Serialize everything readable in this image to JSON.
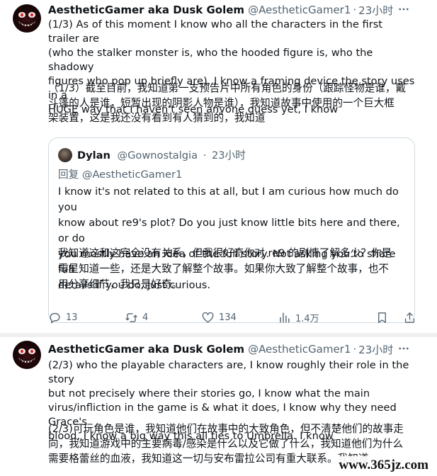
{
  "posts": [
    {
      "author_name": "AestheticGamer aka Dusk Golem",
      "handle": "@AestheticGamer1",
      "separator": "·",
      "time": "23小时",
      "text_en": "(1/3) As of this moment I know who all the characters in the first trailer are\n(who the stalker monster is, who the hooded figure is, who the shadowy\nfigures who pop up briefly are), I know a framing device the story uses in a\nHUGE way that I haven't seen anyone guess yet, I know",
      "text_zh": "（1/3）截至目前，我知道第一支预告片中所有角色的身份（跟踪怪物是谁，戴\n斗篷的人是谁，短暂出现的阴影人物是谁），我知道故事中使用的一个巨大框\n架装置，这是我还没有看到有人猜到的，我知道",
      "quote": {
        "author_name": "Dylan",
        "handle": "@Gownostalgia",
        "separator": "·",
        "time": "23小时",
        "reply_label": "回复",
        "reply_to": "@AestheticGamer1",
        "text_en": "I know it's not related to this at all, but I am curious how much do you\nknow about re9's plot? Do you just know little bits here and there, or do\nyou mostly have  an idea of the full story. Not asking you to share full\ndetails if you do, just curious.",
        "text_zh": "我知道这和这完全没有关系，但我很好奇你对 re9 的剧情了解多少？你是\n零星知道一些，还是大致了解整个故事。如果你大致了解整个故事，也不\n用分享细节，我只是好奇。"
      },
      "actions": {
        "replies": "13",
        "reposts": "4",
        "likes": "134",
        "views": "1.4万"
      }
    },
    {
      "author_name": "AestheticGamer aka Dusk Golem",
      "handle": "@AestheticGamer1",
      "separator": "·",
      "time": "23小时",
      "text_en": "(2/3) who the playable characters are, I know roughly their role in the story\nbut not precisely where their stories go, I know what the main\nvirus/infliction in the game is & what it does, I know why they need Grace's\nblood, I know a big way this all ties to Umbrella. I know",
      "text_zh": "(2/3)可玩角色是谁，我知道他们在故事中的大致角色，但不清楚他们的故事走\n向，我知道游戏中的主要病毒/感染是什么以及它做了什么，我知道他们为什么\n需要格蕾丝的血液，我知道这一切与安布雷拉公司有重大联系。我知道"
    }
  ],
  "watermark": "www.365jz.com",
  "icons": {
    "more": "more-dots-icon",
    "reply": "reply-bubble-icon",
    "repost": "repost-arrows-icon",
    "like": "heart-icon",
    "views": "bar-chart-icon",
    "bookmark": "bookmark-icon",
    "share": "share-icon"
  },
  "colors": {
    "text": "#0f1419",
    "secondary": "#536471",
    "border": "#cfd9de"
  }
}
